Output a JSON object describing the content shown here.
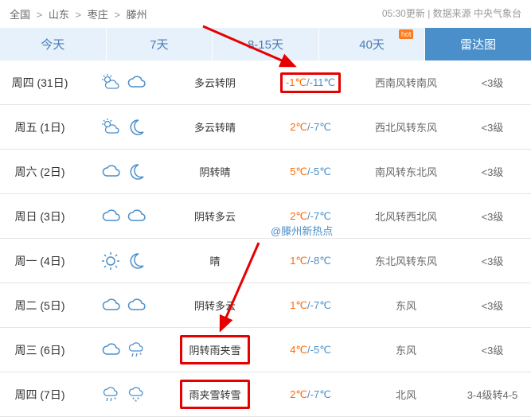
{
  "breadcrumb": {
    "c1": "全国",
    "c2": "山东",
    "c3": "枣庄",
    "c4": "滕州",
    "update": "05:30更新",
    "source": "数据来源 中央气象台"
  },
  "tabs": {
    "t1": "今天",
    "t2": "7天",
    "t3": "8-15天",
    "t4": "40天",
    "t5": "雷达图",
    "hot": "hot"
  },
  "watermark": "@滕州新热点",
  "rows": [
    {
      "day": "周四 (31日)",
      "desc": "多云转阴",
      "hi": "-1℃",
      "lo": "/-11℃",
      "wind": "西南风转南风",
      "level": "<3级",
      "i1": "pcloud-day",
      "i2": "cloud"
    },
    {
      "day": "周五 (1日)",
      "desc": "多云转晴",
      "hi": "2℃",
      "lo": "/-7℃",
      "wind": "西北风转东风",
      "level": "<3级",
      "i1": "pcloud-day",
      "i2": "moon"
    },
    {
      "day": "周六 (2日)",
      "desc": "阴转晴",
      "hi": "5℃",
      "lo": "/-5℃",
      "wind": "南风转东北风",
      "level": "<3级",
      "i1": "cloud",
      "i2": "moon"
    },
    {
      "day": "周日 (3日)",
      "desc": "阴转多云",
      "hi": "2℃",
      "lo": "/-7℃",
      "wind": "北风转西北风",
      "level": "<3级",
      "i1": "cloud",
      "i2": "cloud"
    },
    {
      "day": "周一 (4日)",
      "desc": "晴",
      "hi": "1℃",
      "lo": "/-8℃",
      "wind": "东北风转东风",
      "level": "<3级",
      "i1": "sun",
      "i2": "moon"
    },
    {
      "day": "周二 (5日)",
      "desc": "阴转多云",
      "hi": "1℃",
      "lo": "/-7℃",
      "wind": "东风",
      "level": "<3级",
      "i1": "cloud",
      "i2": "cloud"
    },
    {
      "day": "周三 (6日)",
      "desc": "阴转雨夹雪",
      "hi": "4℃",
      "lo": "/-5℃",
      "wind": "东风",
      "level": "<3级",
      "i1": "cloud",
      "i2": "sleet"
    },
    {
      "day": "周四 (7日)",
      "desc": "雨夹雪转雪",
      "hi": "2℃",
      "lo": "/-7℃",
      "wind": "北风",
      "level": "3-4级转4-5",
      "i1": "sleet",
      "i2": "snow"
    }
  ]
}
